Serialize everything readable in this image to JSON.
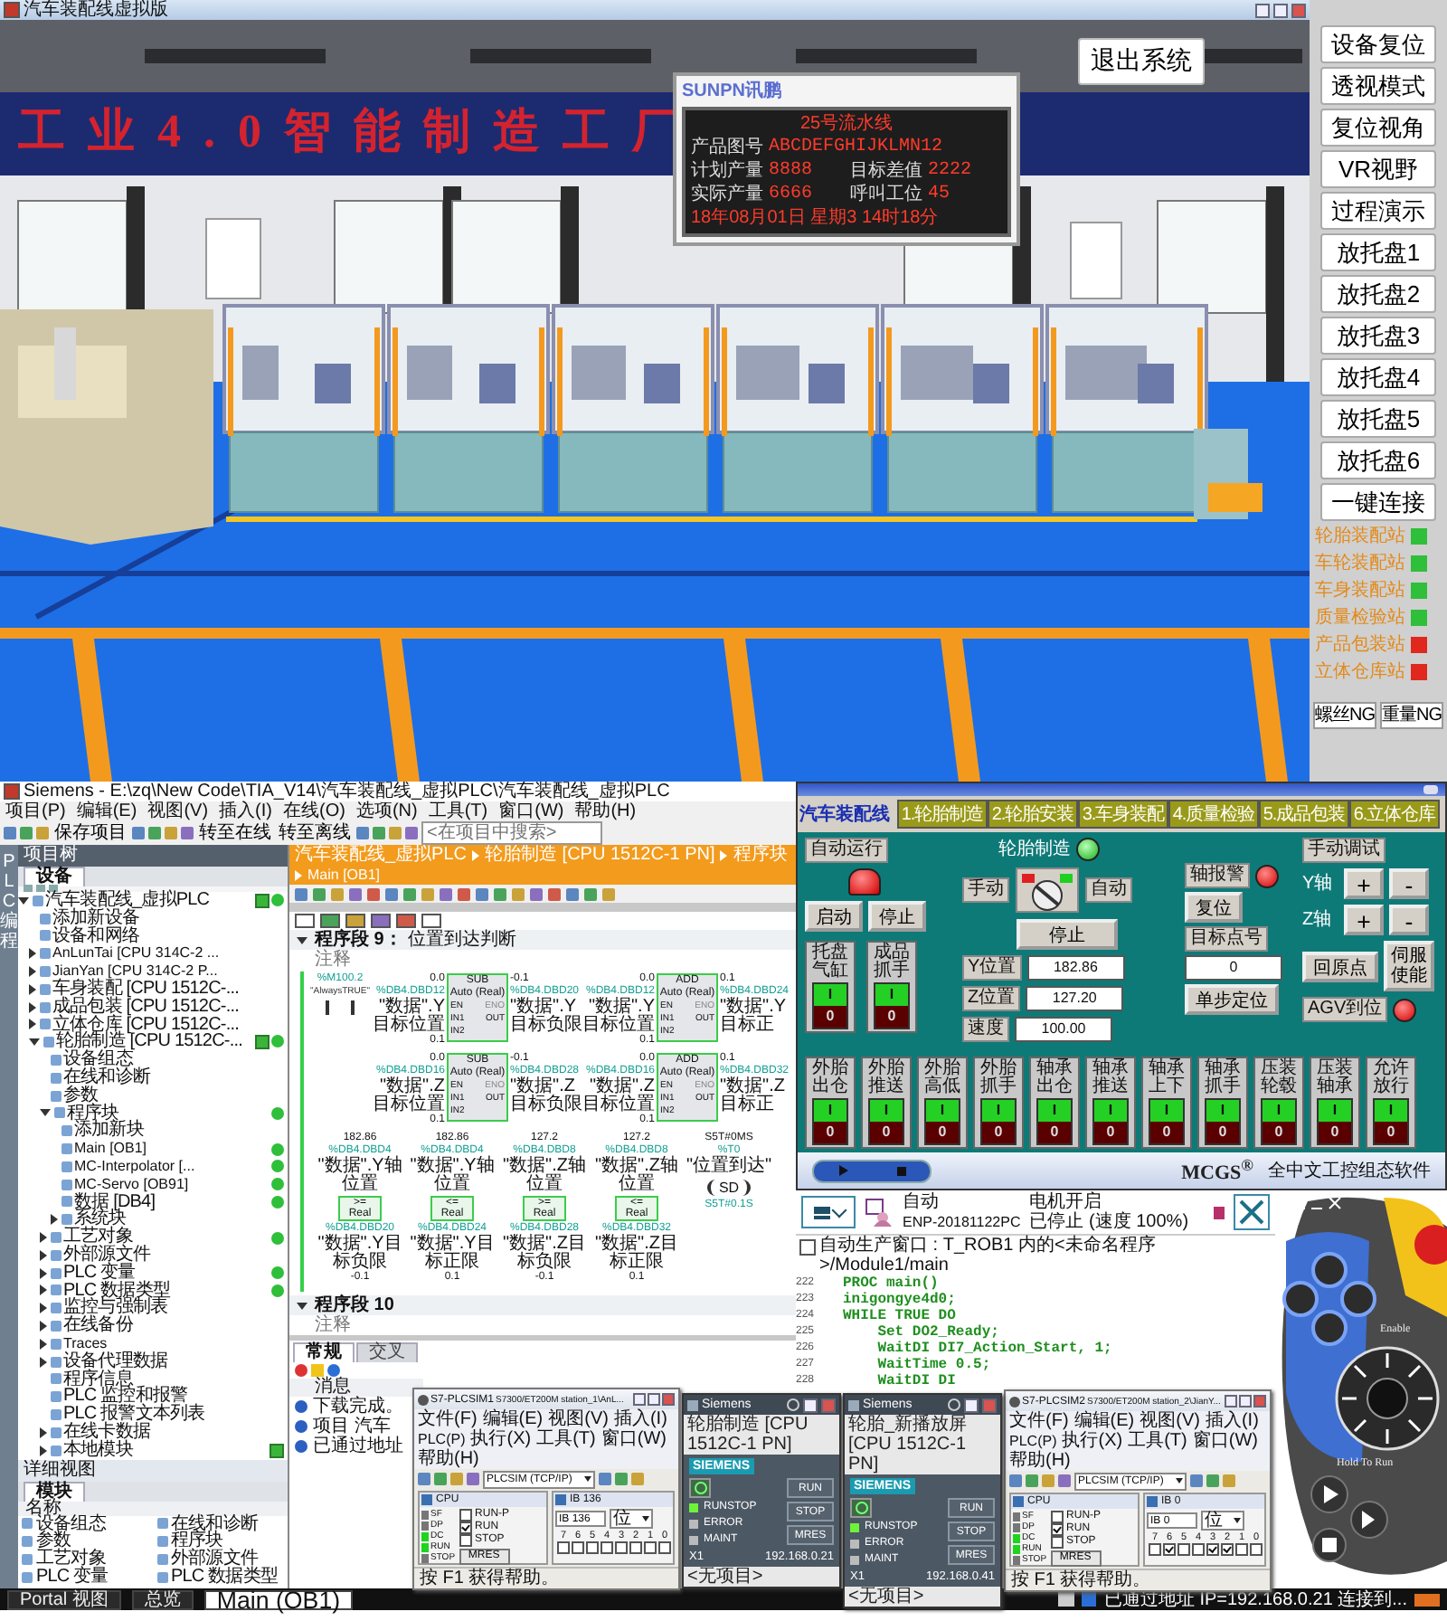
{
  "window": {
    "title": "汽车装配线虚拟版"
  },
  "scene": {
    "banner": "工 业 4 . 0 智 能 制 造 工 厂",
    "exit_button": "退出系统",
    "board": {
      "logo": "SUNPN讯鹏",
      "title": "25号流水线",
      "product_label": "产品图号",
      "product_value": "ABCDEFGHIJKLMN12",
      "cells": [
        {
          "label": "计划产量",
          "value": "8888"
        },
        {
          "label": "目标差值",
          "value": "2222"
        },
        {
          "label": "实际产量",
          "value": "6666"
        },
        {
          "label": "呼叫工位",
          "value": "45"
        }
      ],
      "date": "18年08月01日 星期3 14时18分"
    }
  },
  "side_panel": {
    "buttons": [
      "设备复位",
      "透视模式",
      "复位视角",
      "VR视野",
      "过程演示",
      "放托盘1",
      "放托盘2",
      "放托盘3",
      "放托盘4",
      "放托盘5",
      "放托盘6",
      "一键连接"
    ],
    "stations": [
      {
        "label": "轮胎装配站",
        "color": "#2fbf3a"
      },
      {
        "label": "车轮装配站",
        "color": "#2fbf3a"
      },
      {
        "label": "车身装配站",
        "color": "#2fbf3a"
      },
      {
        "label": "质量检验站",
        "color": "#2fbf3a"
      },
      {
        "label": "产品包装站",
        "color": "#e0281e"
      },
      {
        "label": "立体仓库站",
        "color": "#e0281e"
      }
    ],
    "ng_buttons": [
      "螺丝NG",
      "重量NG"
    ]
  },
  "tia": {
    "title": "Siemens - E:\\zq\\New Code\\TIA_V14\\汽车装配线_虚拟PLC\\汽车装配线_虚拟PLC",
    "menu": [
      "项目(P)",
      "编辑(E)",
      "视图(V)",
      "插入(I)",
      "在线(O)",
      "选项(N)",
      "工具(T)",
      "窗口(W)",
      "帮助(H)"
    ],
    "toolbar": [
      "保存项目",
      "转至在线",
      "转至离线"
    ],
    "search": {
      "placeholder": "<在项目中搜索>"
    },
    "side_tab": "PLC 编程",
    "project_tree": {
      "title": "项目树",
      "tab": {
        "label": "设备",
        "selected": true
      },
      "items": [
        {
          "label": "汽车装配线_虚拟PLC",
          "expanded": true,
          "check": true,
          "dot": true,
          "children": [
            {
              "label": "添加新设备",
              "check": false,
              "dot": false
            },
            {
              "label": "设备和网络",
              "check": false,
              "dot": false
            },
            {
              "label": "AnLunTai [CPU 314C-2 ...",
              "expanded": false,
              "check": false,
              "dot": false
            },
            {
              "label": "JianYan [CPU 314C-2 P...",
              "expanded": false,
              "check": false,
              "dot": false
            },
            {
              "label": "车身装配 [CPU 1512C-...",
              "expanded": false,
              "check": false,
              "dot": false
            },
            {
              "label": "成品包装 [CPU 1512C-...",
              "expanded": false,
              "check": false,
              "dot": false
            },
            {
              "label": "立体仓库 [CPU 1512C-...",
              "expanded": false,
              "check": false,
              "dot": false
            },
            {
              "label": "轮胎制造 [CPU 1512C-...",
              "expanded": true,
              "check": true,
              "dot": true,
              "children": [
                {
                  "label": "设备组态",
                  "check": false,
                  "dot": false
                },
                {
                  "label": "在线和诊断",
                  "check": false,
                  "dot": false
                },
                {
                  "label": "参数",
                  "check": false,
                  "dot": false
                },
                {
                  "label": "程序块",
                  "expanded": true,
                  "check": false,
                  "dot": true,
                  "children": [
                    {
                      "label": "添加新块",
                      "check": false,
                      "dot": false
                    },
                    {
                      "label": "Main [OB1]",
                      "check": false,
                      "dot": true
                    },
                    {
                      "label": "MC-Interpolator [...",
                      "check": false,
                      "dot": true
                    },
                    {
                      "label": "MC-Servo [OB91]",
                      "check": false,
                      "dot": true
                    },
                    {
                      "label": "数据 [DB4]",
                      "check": false,
                      "dot": true
                    },
                    {
                      "label": "系统块",
                      "expanded": false,
                      "check": false,
                      "dot": false
                    }
                  ]
                },
                {
                  "label": "工艺对象",
                  "expanded": false,
                  "check": false,
                  "dot": true
                },
                {
                  "label": "外部源文件",
                  "expanded": false,
                  "check": false,
                  "dot": false
                },
                {
                  "label": "PLC 变量",
                  "expanded": false,
                  "check": false,
                  "dot": true
                },
                {
                  "label": "PLC 数据类型",
                  "expanded": false,
                  "check": false,
                  "dot": true
                },
                {
                  "label": "监控与强制表",
                  "expanded": false,
                  "check": false,
                  "dot": false
                },
                {
                  "label": "在线备份",
                  "expanded": false,
                  "check": false,
                  "dot": false
                },
                {
                  "label": "Traces",
                  "expanded": false,
                  "check": false,
                  "dot": false
                },
                {
                  "label": "设备代理数据",
                  "expanded": false,
                  "check": false,
                  "dot": false
                },
                {
                  "label": "程序信息",
                  "check": false,
                  "dot": false
                },
                {
                  "label": "PLC 监控和报警",
                  "check": false,
                  "dot": false
                },
                {
                  "label": "PLC 报警文本列表",
                  "check": false,
                  "dot": false
                },
                {
                  "label": "在线卡数据",
                  "expanded": false,
                  "check": false,
                  "dot": false
                },
                {
                  "label": "本地模块",
                  "expanded": false,
                  "check": true,
                  "dot": false
                }
              ]
            }
          ]
        }
      ]
    },
    "details": {
      "title": "详细视图",
      "tab": {
        "label": "模块",
        "selected": true
      },
      "column": "名称",
      "items": [
        "设备组态",
        "在线和诊断",
        "参数",
        "程序块",
        "工艺对象",
        "外部源文件",
        "PLC 变量",
        "PLC 数据类型"
      ]
    },
    "editor": {
      "breadcrumb": [
        "汽车装配线_虚拟PLC",
        "轮胎制造 [CPU 1512C-1 PN]",
        "程序块",
        "Main [OB1]"
      ],
      "networks": [
        {
          "title": "程序段 9：",
          "subtitle": "位置到达判断",
          "comment": "注释"
        },
        {
          "title": "程序段 10",
          "comment": "注释"
        }
      ],
      "ladder": {
        "contact": {
          "address": "%M100.2",
          "name": "\"AlwaysTRUE\""
        },
        "boxes": [
          {
            "op": "SUB",
            "type": "Auto (Real)",
            "en": "EN",
            "eno": "ENO",
            "in1_pin": "IN1",
            "in2_pin": "IN2",
            "out_pin": "OUT",
            "in1": {
              "value": "0.0",
              "address": "%DB4.DBD12",
              "name": "\"数据\".Y目标位置"
            },
            "in2": "0.1",
            "out": {
              "value": "-0.1",
              "address": "%DB4.DBD20",
              "name": "\"数据\".Y目标负限"
            }
          },
          {
            "op": "ADD",
            "type": "Auto (Real)",
            "en": "EN",
            "eno": "ENO",
            "in1_pin": "IN1",
            "in2_pin": "IN2",
            "out_pin": "OUT",
            "in1": {
              "value": "0.0",
              "address": "%DB4.DBD12",
              "name": "\"数据\".Y目标位置"
            },
            "in2": "0.1",
            "out": {
              "value": "0.1",
              "address": "%DB4.DBD24",
              "name": "\"数据\".Y目标正"
            }
          },
          {
            "op": "SUB",
            "type": "Auto (Real)",
            "en": "EN",
            "eno": "ENO",
            "in1_pin": "IN1",
            "in2_pin": "IN2",
            "out_pin": "OUT",
            "in1": {
              "value": "0.0",
              "address": "%DB4.DBD16",
              "name": "\"数据\".Z目标位置"
            },
            "in2": "0.1",
            "out": {
              "value": "-0.1",
              "address": "%DB4.DBD28",
              "name": "\"数据\".Z目标负限"
            }
          },
          {
            "op": "ADD",
            "type": "Auto (Real)",
            "en": "EN",
            "eno": "ENO",
            "in1_pin": "IN1",
            "in2_pin": "IN2",
            "out_pin": "OUT",
            "in1": {
              "value": "0.0",
              "address": "%DB4.DBD16",
              "name": "\"数据\".Z目标位置"
            },
            "in2": "0.1",
            "out": {
              "value": "0.1",
              "address": "%DB4.DBD32",
              "name": "\"数据\".Z目标正"
            }
          }
        ],
        "comparators": [
          {
            "op": ">=",
            "type": "Real",
            "top": {
              "value": "182.86",
              "address": "%DB4.DBD4",
              "name": "\"数据\".Y轴位置"
            },
            "bottom": {
              "address": "%DB4.DBD20",
              "name": "\"数据\".Y目标负限",
              "value": "-0.1"
            }
          },
          {
            "op": "<=",
            "type": "Real",
            "top": {
              "value": "182.86",
              "address": "%DB4.DBD4",
              "name": "\"数据\".Y轴位置"
            },
            "bottom": {
              "address": "%DB4.DBD24",
              "name": "\"数据\".Y目标正限",
              "value": "0.1"
            }
          },
          {
            "op": ">=",
            "type": "Real",
            "top": {
              "value": "127.2",
              "address": "%DB4.DBD8",
              "name": "\"数据\".Z轴位置"
            },
            "bottom": {
              "address": "%DB4.DBD28",
              "name": "\"数据\".Z目标负限",
              "value": "-0.1"
            }
          },
          {
            "op": "<=",
            "type": "Real",
            "top": {
              "value": "127.2",
              "address": "%DB4.DBD8",
              "name": "\"数据\".Z轴位置"
            },
            "bottom": {
              "address": "%DB4.DBD32",
              "name": "\"数据\".Z目标正限",
              "value": "0.1"
            }
          }
        ],
        "coil": {
          "value": "S5T#0MS",
          "address": "%T0",
          "name": "\"位置到达\"",
          "op": "SD",
          "time": "S5T#0.1S"
        }
      },
      "inspector": {
        "tabs": [
          {
            "label": "常规",
            "selected": true
          },
          {
            "label": "交叉",
            "selected": false
          }
        ],
        "column": "消息",
        "messages": [
          "下载完成。",
          "项目 汽车",
          "已通过地址"
        ]
      }
    },
    "taskbar": [
      {
        "label": "Portal 视图",
        "selected": false
      },
      {
        "label": "总览",
        "selected": false
      },
      {
        "label": "Main (OB1)",
        "selected": true
      }
    ]
  },
  "hmi": {
    "title": "汽车装配线",
    "tabs": [
      "1.轮胎制造",
      "2.轮胎安装",
      "3.车身装配",
      "4.质量检验",
      "5.成品包装",
      "6.立体仓库"
    ],
    "auto": {
      "label": "自动运行",
      "lamp_on": true,
      "buttons": [
        "启动",
        "停止"
      ]
    },
    "left_switches": [
      {
        "label": "托盘气缸",
        "on": true,
        "on_text": "I",
        "off_text": "0"
      },
      {
        "label": "成品抓手",
        "on": true,
        "on_text": "I",
        "off_text": "0"
      }
    ],
    "station": {
      "label": "轮胎制造",
      "lamp_on": true,
      "manual": "手动",
      "auto": "自动",
      "stop": "停止"
    },
    "positions": [
      {
        "label": "Y位置",
        "value": "182.86"
      },
      {
        "label": "Z位置",
        "value": "127.20"
      },
      {
        "label": "速度",
        "value": "100.00"
      }
    ],
    "alarm": {
      "label": "轴报警",
      "lamp_on": true,
      "reset": "复位"
    },
    "target": {
      "label": "目标点号",
      "value": "0",
      "button": "单步定位"
    },
    "jog": {
      "title": "手动调试",
      "axes": [
        {
          "label": "Y轴",
          "plus": "+",
          "minus": "-"
        },
        {
          "label": "Z轴",
          "plus": "+",
          "minus": "-"
        }
      ],
      "home": "回原点",
      "servo": "伺服使能"
    },
    "agv": {
      "label": "AGV到位",
      "lamp_on": true
    },
    "switches": [
      {
        "label": "外胎出仓",
        "on": true,
        "on_text": "I",
        "off_text": "0"
      },
      {
        "label": "外胎推送",
        "on": true,
        "on_text": "I",
        "off_text": "0"
      },
      {
        "label": "外胎高低",
        "on": true,
        "on_text": "I",
        "off_text": "0"
      },
      {
        "label": "外胎抓手",
        "on": true,
        "on_text": "I",
        "off_text": "0"
      },
      {
        "label": "轴承出仓",
        "on": true,
        "on_text": "I",
        "off_text": "0"
      },
      {
        "label": "轴承推送",
        "on": true,
        "on_text": "I",
        "off_text": "0"
      },
      {
        "label": "轴承上下",
        "on": true,
        "on_text": "I",
        "off_text": "0"
      },
      {
        "label": "轴承抓手",
        "on": true,
        "on_text": "I",
        "off_text": "0"
      },
      {
        "label": "压装轮毂",
        "on": true,
        "on_text": "I",
        "off_text": "0"
      },
      {
        "label": "压装轴承",
        "on": true,
        "on_text": "I",
        "off_text": "0"
      },
      {
        "label": "允许放行",
        "on": true,
        "on_text": "I",
        "off_text": "0"
      }
    ],
    "brand": "MCGS$^{®}$",
    "tagline": "全中文工控组态软件"
  },
  "robot": {
    "status": [
      {
        "title": "自动",
        "detail": "ENP-20181122PC"
      },
      {
        "title": "电机开启",
        "detail": "已停止 (速度 100%)"
      }
    ],
    "path": "自动生产窗口 : T_ROB1 内的<未命名程序>/Module1/main",
    "code": [
      {
        "number": "222",
        "text": "PROC main()"
      },
      {
        "number": "223",
        "text": "inigongye4d0;"
      },
      {
        "number": "224",
        "text": "WHILE TRUE DO"
      },
      {
        "number": "225",
        "text": "    Set DO2_Ready;"
      },
      {
        "number": "226",
        "text": "    WaitDI DI7_Action_Start, 1;"
      },
      {
        "number": "227",
        "text": "    WaitTime 0.5;"
      },
      {
        "number": "228",
        "text": "    WaitDI DI"
      }
    ],
    "pendant": {
      "enable": "Enable",
      "hold": "Hold To Run"
    },
    "status_bar": "已通过地址 IP=192.168.0.21 连接到..."
  },
  "plcsim": [
    {
      "title": "S7-PLCSIM1",
      "station": "S7300/ET200M station_1\\AnL...",
      "menu": [
        "文件(F)",
        "编辑(E)",
        "视图(V)",
        "插入(I)",
        "PLC(P)",
        "执行(X)",
        "工具(T)",
        "窗口(W)",
        "帮助(H)"
      ],
      "connection": "PLCSIM (TCP/IP)",
      "cpu": {
        "title": "CPU",
        "leds": [
          {
            "label": "SF",
            "on": false
          },
          {
            "label": "DP",
            "on": false
          },
          {
            "label": "DC",
            "on": true
          },
          {
            "label": "RUN",
            "on": true
          },
          {
            "label": "STOP",
            "on": false
          }
        ],
        "modes": [
          {
            "label": "RUN-P",
            "checked": false
          },
          {
            "label": "RUN",
            "checked": true
          },
          {
            "label": "STOP",
            "checked": false
          }
        ],
        "mres": "MRES"
      },
      "input": {
        "title": "IB 136",
        "address": "IB 136",
        "format": "位",
        "bits": [
          {
            "label": "7",
            "checked": false
          },
          {
            "label": "6",
            "checked": false
          },
          {
            "label": "5",
            "checked": false
          },
          {
            "label": "4",
            "checked": false
          },
          {
            "label": "3",
            "checked": false
          },
          {
            "label": "2",
            "checked": false
          },
          {
            "label": "1",
            "checked": false
          },
          {
            "label": "0",
            "checked": false
          }
        ]
      },
      "status": "按 F1 获得帮助。"
    },
    {
      "title": "S7-PLCSIM2",
      "station": "S7300/ET200M station_2\\JianY...",
      "menu": [
        "文件(F)",
        "编辑(E)",
        "视图(V)",
        "插入(I)",
        "PLC(P)",
        "执行(X)",
        "工具(T)",
        "窗口(W)",
        "帮助(H)"
      ],
      "connection": "PLCSIM (TCP/IP)",
      "cpu": {
        "title": "CPU",
        "leds": [
          {
            "label": "SF",
            "on": false
          },
          {
            "label": "DP",
            "on": false
          },
          {
            "label": "DC",
            "on": true
          },
          {
            "label": "RUN",
            "on": true
          },
          {
            "label": "STOP",
            "on": false
          }
        ],
        "modes": [
          {
            "label": "RUN-P",
            "checked": false
          },
          {
            "label": "RUN",
            "checked": true
          },
          {
            "label": "STOP",
            "checked": false
          }
        ],
        "mres": "MRES"
      },
      "input": {
        "title": "IB 0",
        "address": "IB 0",
        "format": "位",
        "bits": [
          {
            "label": "7",
            "checked": false
          },
          {
            "label": "6",
            "checked": true
          },
          {
            "label": "5",
            "checked": false
          },
          {
            "label": "4",
            "checked": false
          },
          {
            "label": "3",
            "checked": true
          },
          {
            "label": "2",
            "checked": true
          },
          {
            "label": "1",
            "checked": false
          },
          {
            "label": "0",
            "checked": false
          }
        ]
      },
      "status": "按 F1 获得帮助。"
    }
  ],
  "siemens_panels": [
    {
      "title": "Siemens",
      "device": "轮胎制造 [CPU 1512C-1 PN]",
      "brand": "SIEMENS",
      "leds": [
        {
          "label": "RUNSTOP",
          "on": true
        },
        {
          "label": "ERROR",
          "on": false
        },
        {
          "label": "MAINT",
          "on": false
        }
      ],
      "buttons": [
        "RUN",
        "STOP",
        "MRES"
      ],
      "port": "X1",
      "ip": "192.168.0.21",
      "project": "<无项目>"
    },
    {
      "title": "Siemens",
      "device": "轮胎_新播放屏 [CPU 1512C-1 PN]",
      "brand": "SIEMENS",
      "leds": [
        {
          "label": "RUNSTOP",
          "on": true
        },
        {
          "label": "ERROR",
          "on": false
        },
        {
          "label": "MAINT",
          "on": false
        }
      ],
      "buttons": [
        "RUN",
        "STOP",
        "MRES"
      ],
      "port": "X1",
      "ip": "192.168.0.41",
      "project": "<无项目>"
    }
  ]
}
